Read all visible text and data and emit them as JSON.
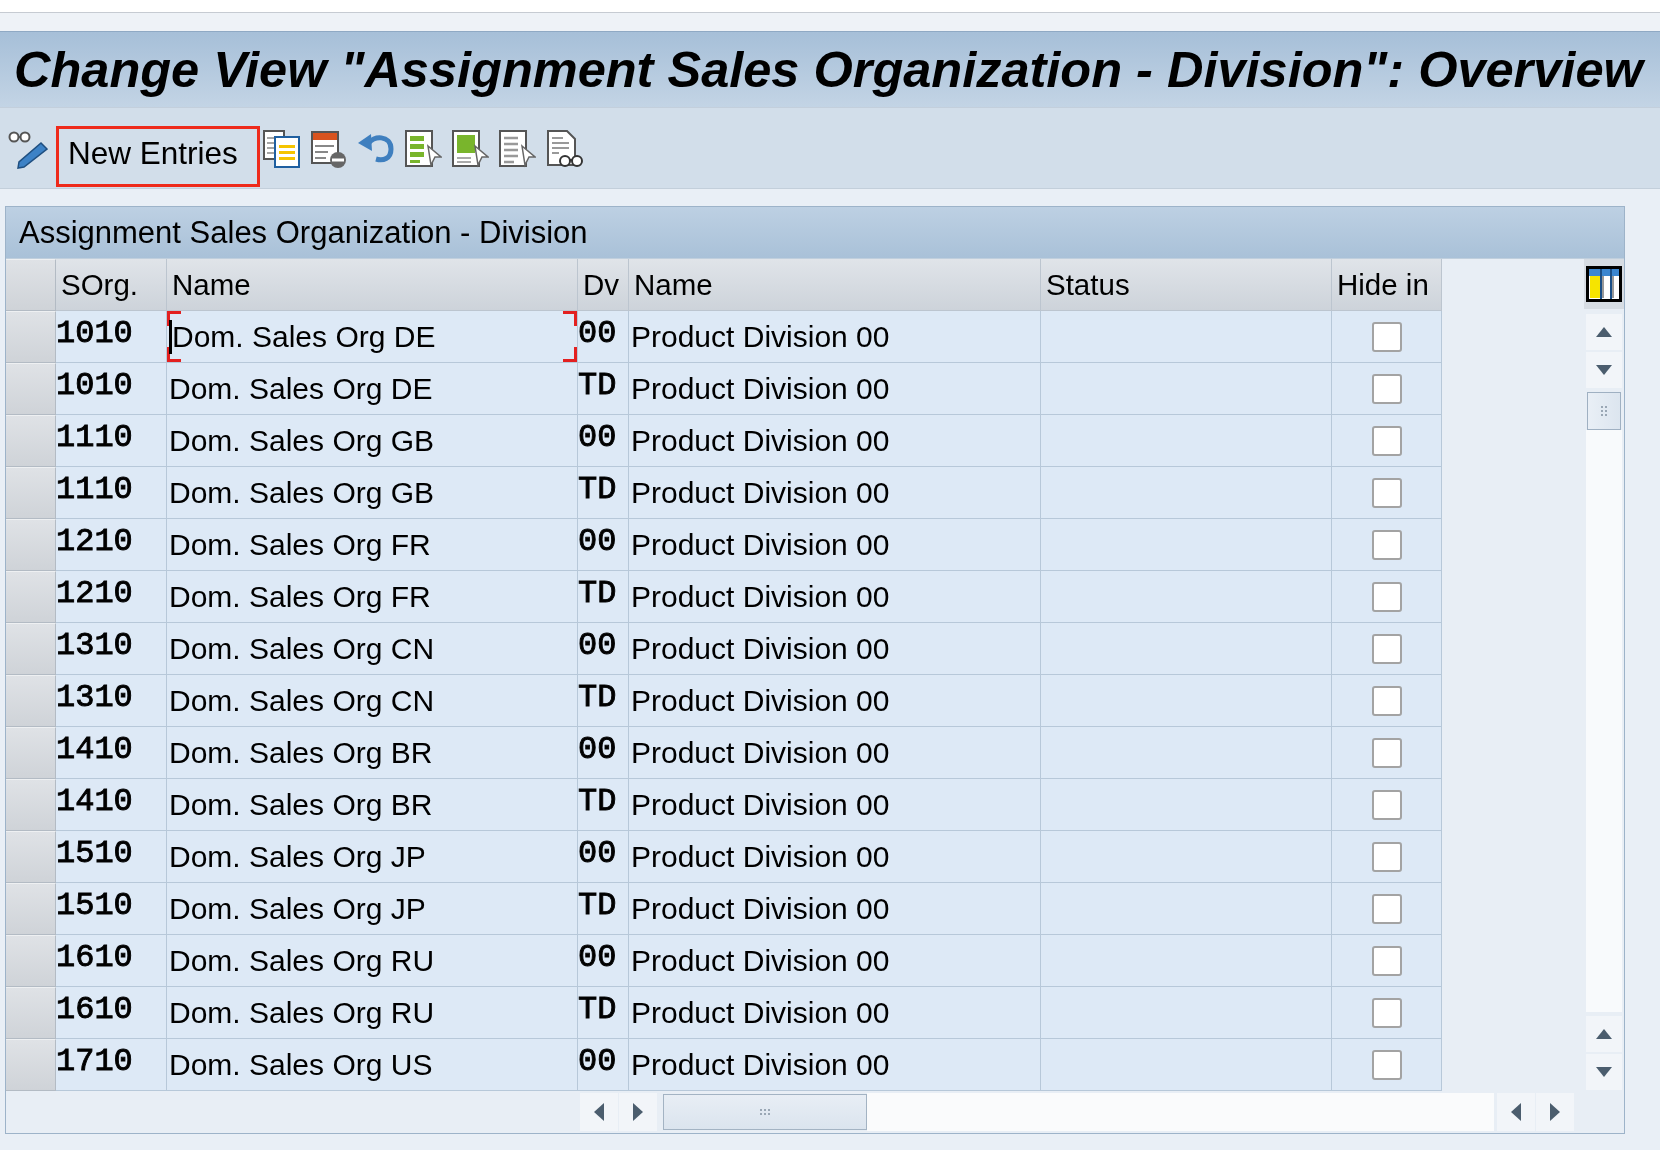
{
  "window": {
    "title": "Change View \"Assignment Sales Organization - Division\": Overview"
  },
  "toolbar": {
    "new_entries": {
      "label": "New Entries",
      "highlighted": true
    }
  },
  "table": {
    "title": "Assignment Sales Organization - Division",
    "columns": [
      "SOrg.",
      "Name",
      "Dv",
      "Name",
      "Status",
      "Hide in"
    ],
    "rows": [
      {
        "selected": false,
        "sorg": "1010",
        "sorg_name": "Dom. Sales Org DE",
        "focused": true,
        "dv": "00",
        "dv_name": "Product Division 00",
        "checked": false
      },
      {
        "selected": false,
        "sorg": "1010",
        "sorg_name": "Dom. Sales Org DE",
        "focused": false,
        "dv": "TD",
        "dv_name": "Product Division 00",
        "checked": false
      },
      {
        "selected": false,
        "sorg": "1110",
        "sorg_name": "Dom. Sales Org GB",
        "focused": false,
        "dv": "00",
        "dv_name": "Product Division 00",
        "checked": false
      },
      {
        "selected": false,
        "sorg": "1110",
        "sorg_name": "Dom. Sales Org GB",
        "focused": false,
        "dv": "TD",
        "dv_name": "Product Division 00",
        "checked": false
      },
      {
        "selected": false,
        "sorg": "1210",
        "sorg_name": "Dom. Sales Org FR",
        "focused": false,
        "dv": "00",
        "dv_name": "Product Division 00",
        "checked": false
      },
      {
        "selected": false,
        "sorg": "1210",
        "sorg_name": "Dom. Sales Org FR",
        "focused": false,
        "dv": "TD",
        "dv_name": "Product Division 00",
        "checked": false
      },
      {
        "selected": false,
        "sorg": "1310",
        "sorg_name": "Dom. Sales Org CN",
        "focused": false,
        "dv": "00",
        "dv_name": "Product Division 00",
        "checked": false
      },
      {
        "selected": false,
        "sorg": "1310",
        "sorg_name": "Dom. Sales Org CN",
        "focused": false,
        "dv": "TD",
        "dv_name": "Product Division 00",
        "checked": false
      },
      {
        "selected": false,
        "sorg": "1410",
        "sorg_name": "Dom. Sales Org BR",
        "focused": false,
        "dv": "00",
        "dv_name": "Product Division 00",
        "checked": false
      },
      {
        "selected": false,
        "sorg": "1410",
        "sorg_name": "Dom. Sales Org BR",
        "focused": false,
        "dv": "TD",
        "dv_name": "Product Division 00",
        "checked": false
      },
      {
        "selected": false,
        "sorg": "1510",
        "sorg_name": "Dom. Sales Org JP",
        "focused": false,
        "dv": "00",
        "dv_name": "Product Division 00",
        "checked": false
      },
      {
        "selected": false,
        "sorg": "1510",
        "sorg_name": "Dom. Sales Org JP",
        "focused": false,
        "dv": "TD",
        "dv_name": "Product Division 00",
        "checked": false
      },
      {
        "selected": false,
        "sorg": "1610",
        "sorg_name": "Dom. Sales Org RU",
        "focused": false,
        "dv": "00",
        "dv_name": "Product Division 00",
        "checked": false
      },
      {
        "selected": false,
        "sorg": "1610",
        "sorg_name": "Dom. Sales Org RU",
        "focused": false,
        "dv": "TD",
        "dv_name": "Product Division 00",
        "checked": false
      },
      {
        "selected": false,
        "sorg": "1710",
        "sorg_name": "Dom. Sales Org US",
        "focused": false,
        "dv": "00",
        "dv_name": "Product Division 00",
        "checked": false
      }
    ]
  }
}
